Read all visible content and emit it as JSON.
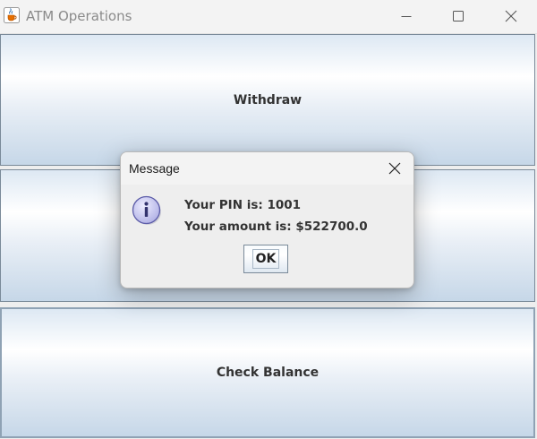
{
  "window": {
    "title": "ATM Operations",
    "icon": "java-coffee-cup-icon",
    "controls": [
      "minimize-icon",
      "maximize-icon",
      "close-icon"
    ]
  },
  "buttons": {
    "withdraw": "Withdraw",
    "deposit": "",
    "check_balance": "Check Balance"
  },
  "dialog": {
    "title": "Message",
    "icon": "information-icon",
    "line1": "Your PIN is: 1001",
    "line2": "Your amount is: $522700.0",
    "ok_label": "OK"
  },
  "colors": {
    "button_gradient_top": "#dde8f3",
    "button_gradient_bottom": "#c6d7e8",
    "button_border": "#7a8a99",
    "info_icon_fill": "#c8c8ee",
    "info_icon_stroke": "#5c5ca8"
  }
}
